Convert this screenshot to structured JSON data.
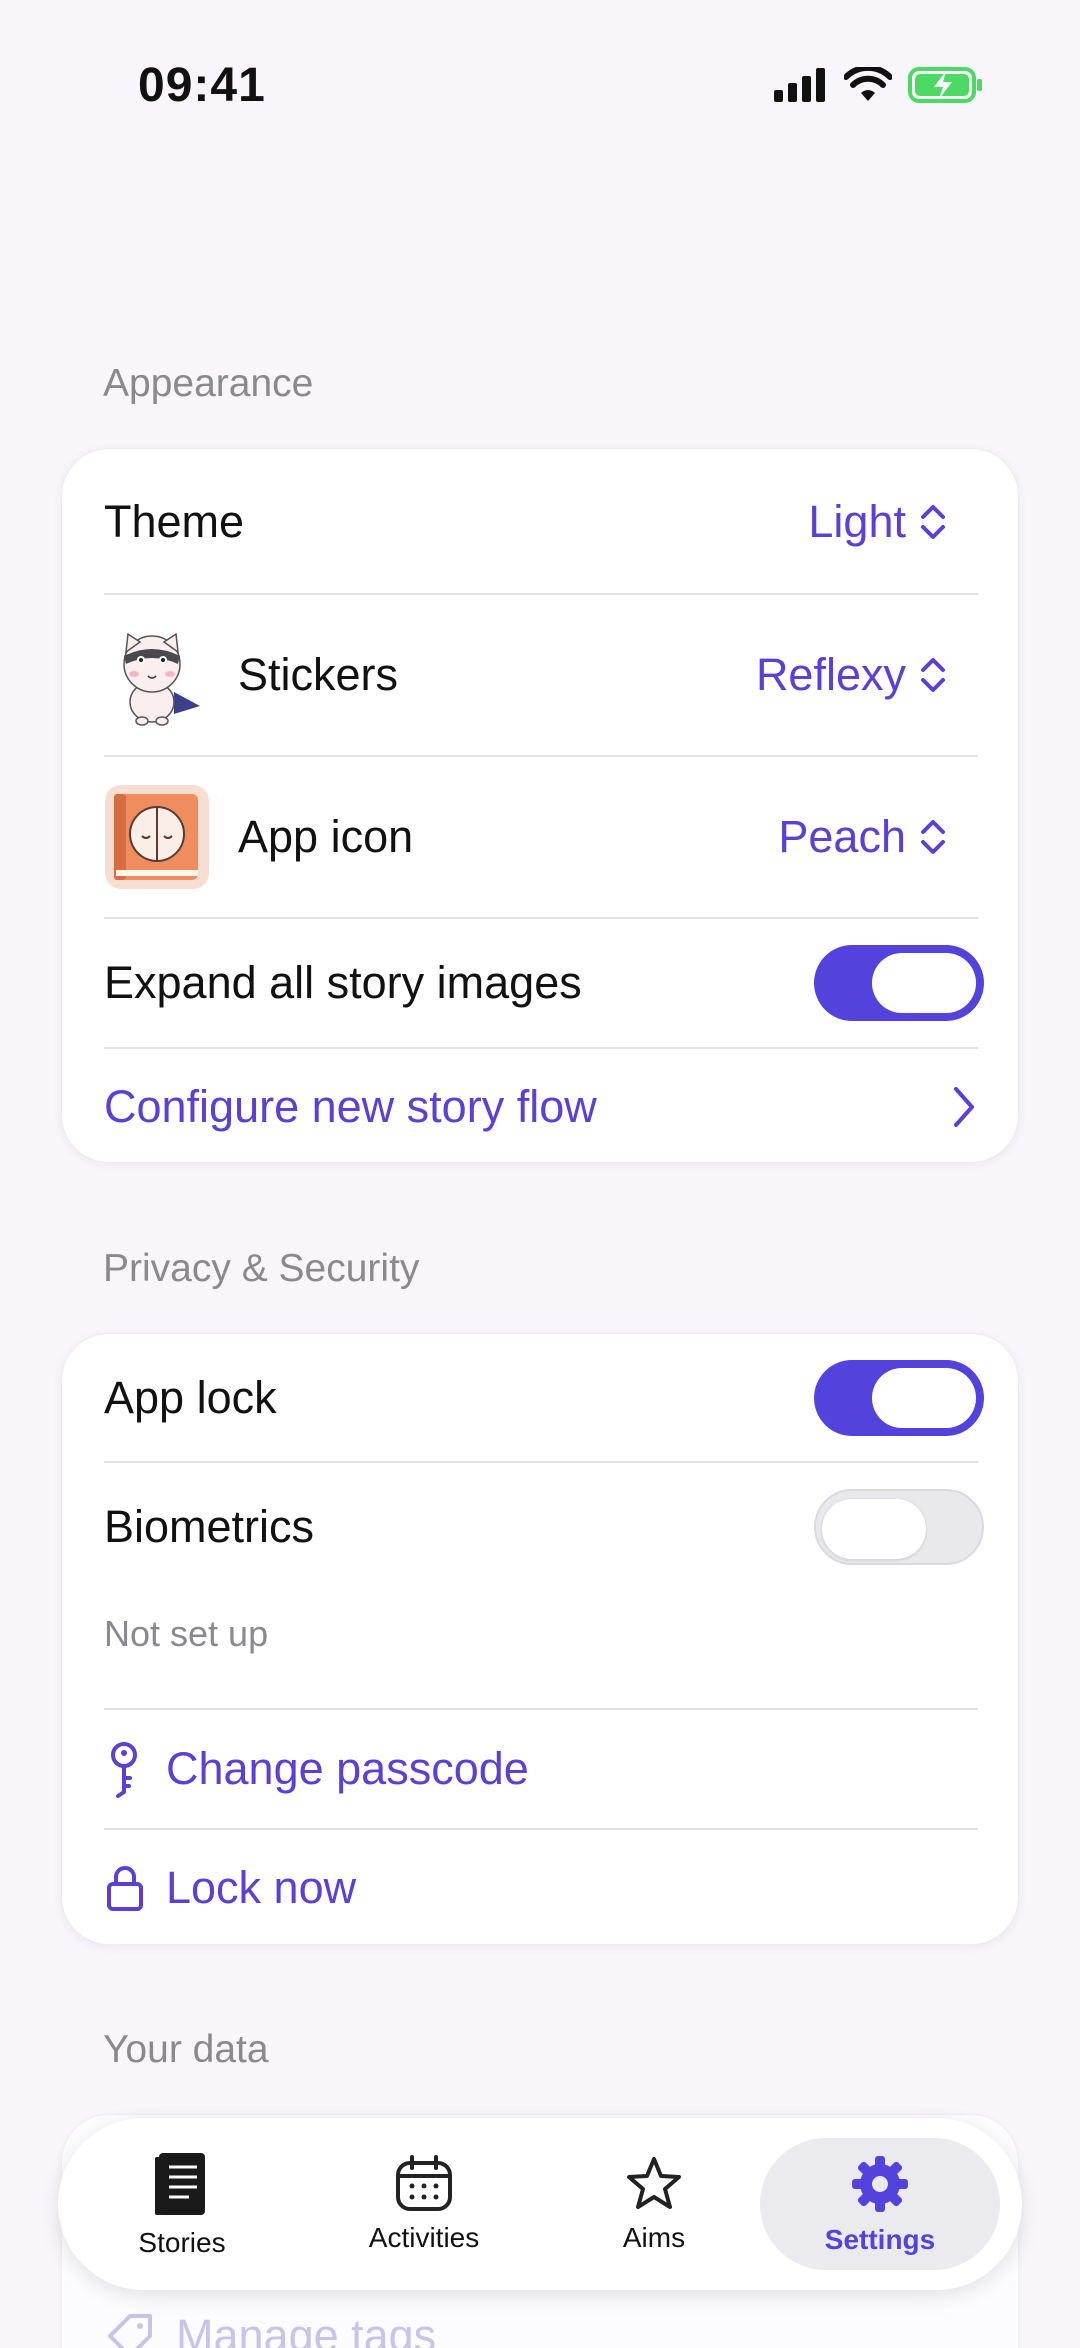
{
  "status_bar": {
    "time": "09:41"
  },
  "appearance": {
    "section_label": "Appearance",
    "theme": {
      "label": "Theme",
      "value": "Light"
    },
    "stickers": {
      "label": "Stickers",
      "value": "Reflexy"
    },
    "app_icon": {
      "label": "App icon",
      "value": "Peach"
    },
    "expand_images": {
      "label": "Expand all story images",
      "enabled": true
    },
    "configure_flow": {
      "label": "Configure new story flow"
    }
  },
  "privacy": {
    "section_label": "Privacy & Security",
    "app_lock": {
      "label": "App lock",
      "enabled": true
    },
    "biometrics": {
      "label": "Biometrics",
      "enabled": false,
      "status": "Not set up"
    },
    "change_passcode": {
      "label": "Change passcode"
    },
    "lock_now": {
      "label": "Lock now"
    }
  },
  "your_data": {
    "section_label": "Your data",
    "manage_tags": {
      "label": "Manage tags"
    }
  },
  "tab_bar": {
    "tabs": [
      {
        "label": "Stories",
        "icon": "book-icon"
      },
      {
        "label": "Activities",
        "icon": "calendar-icon"
      },
      {
        "label": "Aims",
        "icon": "star-icon"
      },
      {
        "label": "Settings",
        "icon": "gear-icon"
      }
    ],
    "active_tab": "Settings"
  },
  "colors": {
    "accent": "#5342dc",
    "link": "#5b3fd6",
    "background": "#f8f6fa",
    "secondary_text": "#8a8a8e",
    "battery": "#4cd964"
  }
}
